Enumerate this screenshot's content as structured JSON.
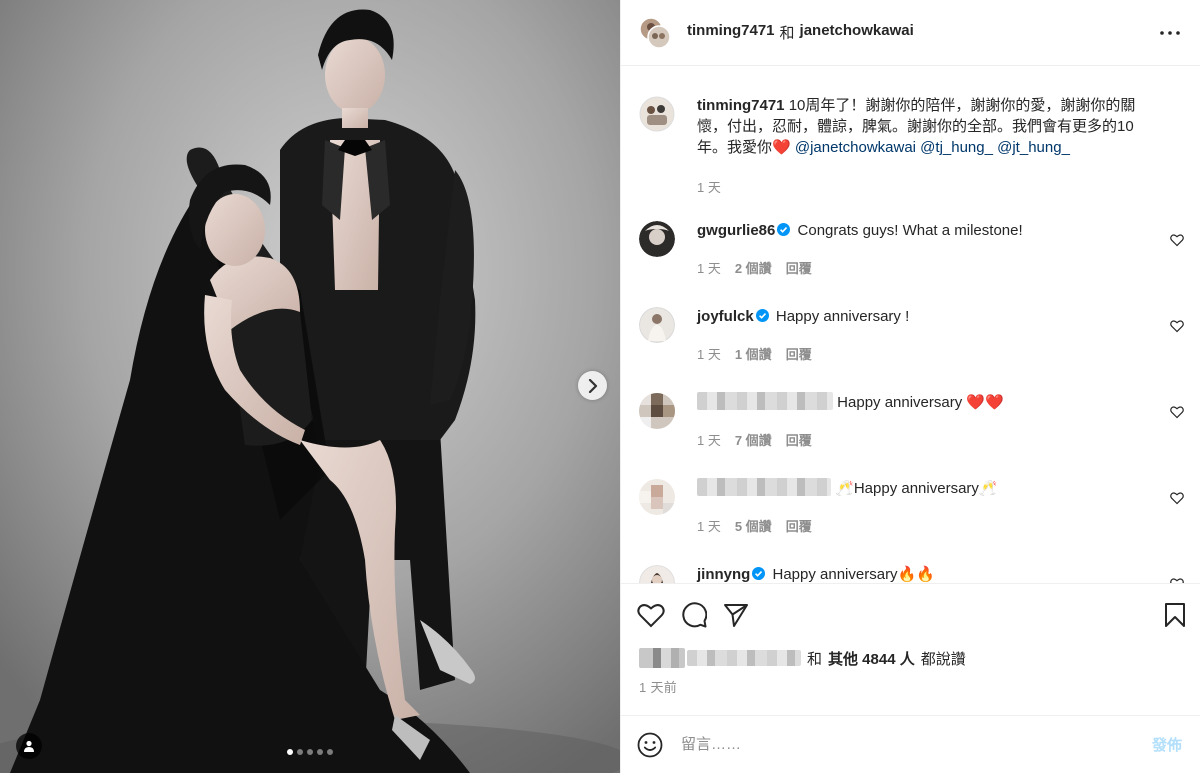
{
  "header": {
    "owner": "tinming7471",
    "joiner": "和",
    "collaborator": "janetchowkawai",
    "more_icon": "more-horizontal-icon"
  },
  "caption": {
    "username": "tinming7471",
    "text": "10周年了！謝謝你的陪伴，謝謝你的愛，謝謝你的關懷，付出，忍耐，體諒，脾氣。謝謝你的全部。我們會有更多的10年。我愛你",
    "heart": "❤️",
    "mentions": [
      "@janetchowkawai",
      "@tj_hung_",
      "@jt_hung_"
    ],
    "time": "1 天"
  },
  "comments": [
    {
      "username": "gwgurlie86",
      "verified": true,
      "text": "Congrats guys! What a milestone!",
      "time": "1 天",
      "likes": "2 個讚",
      "reply": "回覆"
    },
    {
      "username": "joyfulck",
      "verified": true,
      "text": "Happy anniversary !",
      "time": "1 天",
      "likes": "1 個讚",
      "reply": "回覆"
    },
    {
      "username": "",
      "verified": false,
      "text": "Happy anniversary ❤️❤️",
      "time": "1 天",
      "likes": "7 個讚",
      "reply": "回覆"
    },
    {
      "username": "",
      "verified": false,
      "text": "🥂Happy anniversary🥂",
      "time": "1 天",
      "likes": "5 個讚",
      "reply": "回覆"
    },
    {
      "username": "jinnyng",
      "verified": true,
      "text": "Happy anniversary🔥🔥",
      "time": "",
      "likes": "",
      "reply": ""
    }
  ],
  "actions": {
    "like_icon": "heart-outline-icon",
    "comment_icon": "comment-icon",
    "share_icon": "paper-plane-icon",
    "save_icon": "bookmark-icon"
  },
  "likes_line": {
    "and": "和",
    "others": "其他 4844 人",
    "suffix": "都說讚"
  },
  "post_time": "1 天前",
  "composer": {
    "emoji_icon": "smiley-icon",
    "placeholder": "留言……",
    "post_label": "發佈"
  },
  "carousel": {
    "total": 5,
    "active": 0,
    "next_icon": "chevron-right-icon",
    "tag_icon": "user-tag-icon"
  },
  "colors": {
    "text": "#262626",
    "muted": "#8e8e8e",
    "link": "#00376b",
    "verified": "#0095f6",
    "post_disabled": "#b2dffc"
  }
}
